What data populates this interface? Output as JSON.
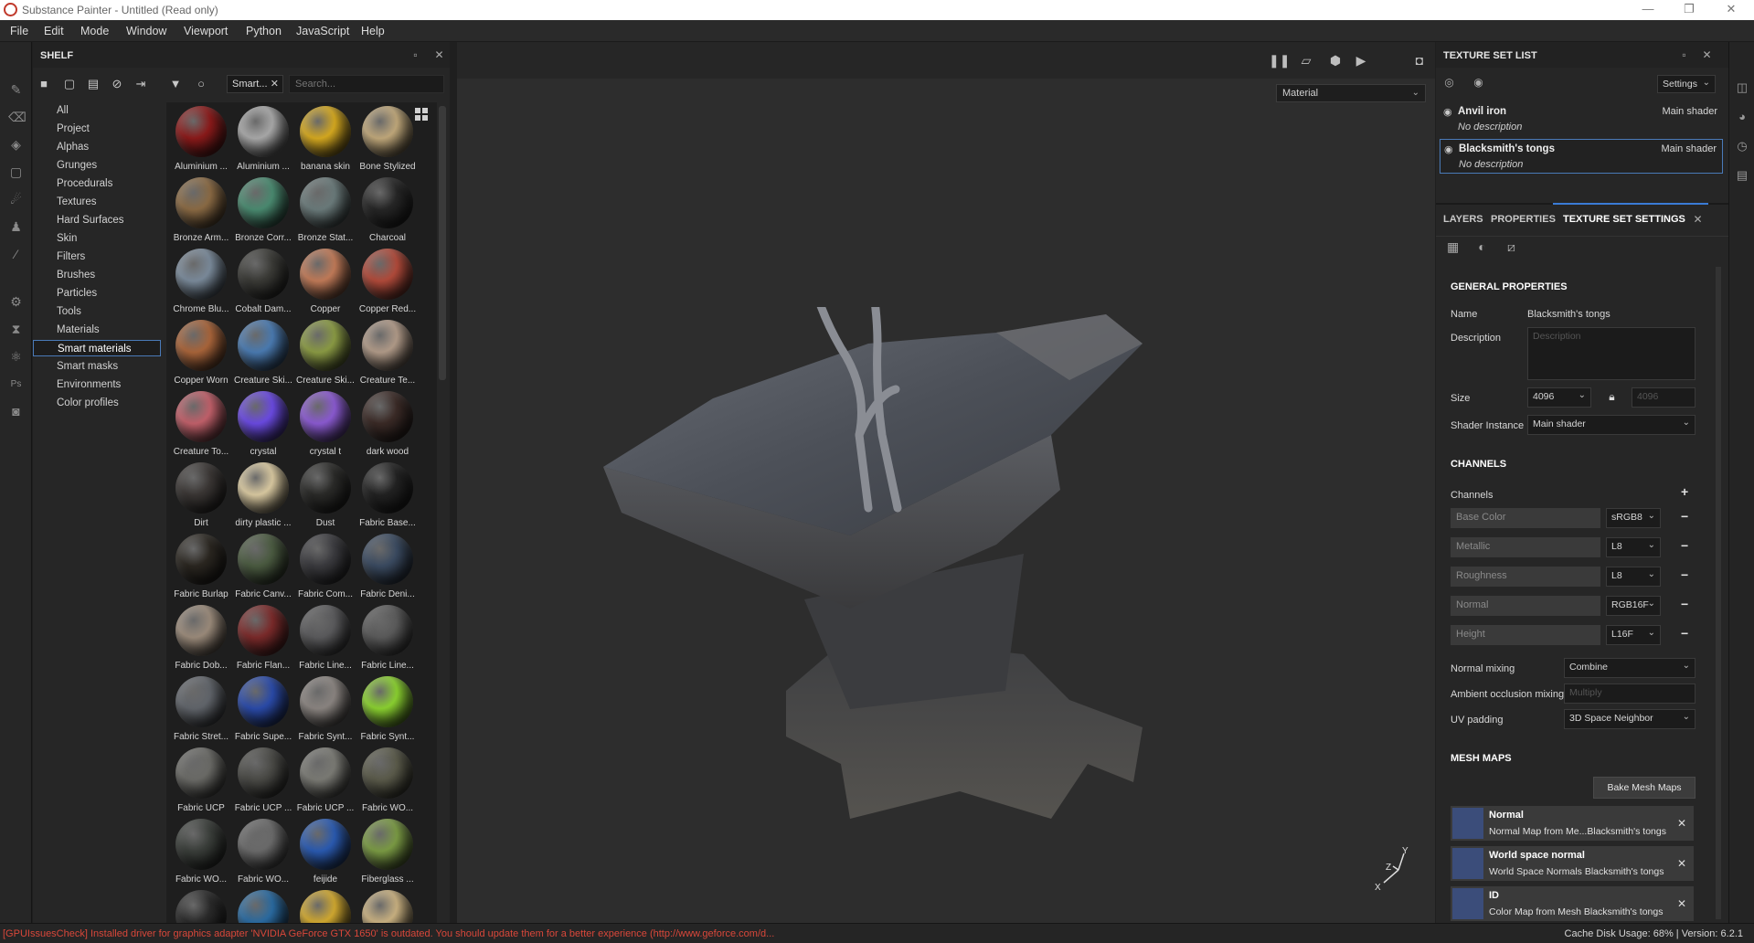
{
  "window": {
    "title": "Substance Painter - Untitled (Read only)",
    "controls": [
      "—",
      "❐",
      "✕"
    ]
  },
  "menu": [
    "File",
    "Edit",
    "Mode",
    "Window",
    "Viewport",
    "Python",
    "JavaScript",
    "Help"
  ],
  "shelf": {
    "title": "SHELF",
    "filter_tag": "Smart...",
    "search_placeholder": "Search...",
    "categories": [
      "All",
      "Project",
      "Alphas",
      "Grunges",
      "Procedurals",
      "Textures",
      "Hard Surfaces",
      "Skin",
      "Filters",
      "Brushes",
      "Particles",
      "Tools",
      "Materials",
      "Smart materials",
      "Smart masks",
      "Environments",
      "Color profiles"
    ],
    "selected_category": "Smart materials",
    "materials": [
      {
        "label": "Aluminium ...",
        "color": "#8a1a1a"
      },
      {
        "label": "Aluminium ...",
        "color": "#a8a8a8"
      },
      {
        "label": "banana skin",
        "color": "#d4a820"
      },
      {
        "label": "Bone Stylized",
        "color": "#bfa77a"
      },
      {
        "label": "Bronze Arm...",
        "color": "#8a6a44"
      },
      {
        "label": "Bronze Corr...",
        "color": "#4a8a70"
      },
      {
        "label": "Bronze Stat...",
        "color": "#6a7a7a"
      },
      {
        "label": "Charcoal",
        "color": "#262626"
      },
      {
        "label": "Chrome Blu...",
        "color": "#7a8a9a"
      },
      {
        "label": "Cobalt Dam...",
        "color": "#3a3a36"
      },
      {
        "label": "Copper",
        "color": "#c07a58"
      },
      {
        "label": "Copper Red...",
        "color": "#b04a3a"
      },
      {
        "label": "Copper Worn",
        "color": "#a8643a"
      },
      {
        "label": "Creature Ski...",
        "color": "#4a7ab0"
      },
      {
        "label": "Creature Ski...",
        "color": "#8a9a44"
      },
      {
        "label": "Creature Te...",
        "color": "#b09a88"
      },
      {
        "label": "Creature To...",
        "color": "#c0606a"
      },
      {
        "label": "crystal",
        "color": "#6a4ae0"
      },
      {
        "label": "crystal t",
        "color": "#8a5ad0"
      },
      {
        "label": "dark wood",
        "color": "#3a2a26"
      },
      {
        "label": "Dirt",
        "color": "#3a3634"
      },
      {
        "label": "dirty plastic ...",
        "color": "#d8c8a0"
      },
      {
        "label": "Dust",
        "color": "#2a2a28"
      },
      {
        "label": "Fabric Base...",
        "color": "#222222"
      },
      {
        "label": "Fabric Burlap",
        "color": "#2a2620"
      },
      {
        "label": "Fabric Canv...",
        "color": "#4a5a40"
      },
      {
        "label": "Fabric Com...",
        "color": "#3a3a3e"
      },
      {
        "label": "Fabric Deni...",
        "color": "#3a4a60"
      },
      {
        "label": "Fabric Dob...",
        "color": "#9a8a7a"
      },
      {
        "label": "Fabric Flan...",
        "color": "#7a2a2a"
      },
      {
        "label": "Fabric Line...",
        "color": "#5a5a5c"
      },
      {
        "label": "Fabric Line...",
        "color": "#5a5a5a"
      },
      {
        "label": "Fabric Stret...",
        "color": "#60646a"
      },
      {
        "label": "Fabric Supe...",
        "color": "#2a4aa8"
      },
      {
        "label": "Fabric Synt...",
        "color": "#8a8480"
      },
      {
        "label": "Fabric Synt...",
        "color": "#8ad030"
      },
      {
        "label": "Fabric UCP",
        "color": "#6a6a66"
      },
      {
        "label": "Fabric UCP ...",
        "color": "#4a4a46"
      },
      {
        "label": "Fabric UCP ...",
        "color": "#7a7a74"
      },
      {
        "label": "Fabric WO...",
        "color": "#5a5a4a"
      },
      {
        "label": "Fabric WO...",
        "color": "#3a3e3a"
      },
      {
        "label": "Fabric WO...",
        "color": "#6a6a6a"
      },
      {
        "label": "feijide",
        "color": "#2a5ab0"
      },
      {
        "label": "Fiberglass ...",
        "color": "#7a9a44"
      },
      {
        "label": "",
        "color": "#2a2a2a"
      },
      {
        "label": "",
        "color": "#2a6aa0"
      },
      {
        "label": "",
        "color": "#d0a830"
      },
      {
        "label": "",
        "color": "#c8b080"
      }
    ]
  },
  "viewport": {
    "render_mode": "Material",
    "axis": {
      "x": "X",
      "y": "Y",
      "z": "Z"
    }
  },
  "texture_set_list": {
    "title": "TEXTURE SET LIST",
    "settings_label": "Settings",
    "items": [
      {
        "name": "Anvil iron",
        "description": "No description",
        "shader": "Main shader"
      },
      {
        "name": "Blacksmith's tongs",
        "description": "No description",
        "shader": "Main shader"
      }
    ]
  },
  "tabs": [
    "LAYERS",
    "PROPERTIES",
    "TEXTURE SET SETTINGS"
  ],
  "settings": {
    "general_title": "GENERAL PROPERTIES",
    "name_label": "Name",
    "name_value": "Blacksmith's tongs",
    "description_label": "Description",
    "description_placeholder": "Description",
    "size_label": "Size",
    "size_value": "4096",
    "size_value_locked": "4096",
    "shader_label": "Shader Instance",
    "shader_value": "Main shader",
    "channels_title": "CHANNELS",
    "channels_label": "Channels",
    "channels": [
      {
        "name": "Base Color",
        "format": "sRGB8"
      },
      {
        "name": "Metallic",
        "format": "L8"
      },
      {
        "name": "Roughness",
        "format": "L8"
      },
      {
        "name": "Normal",
        "format": "RGB16F"
      },
      {
        "name": "Height",
        "format": "L16F"
      }
    ],
    "normal_mixing_label": "Normal mixing",
    "normal_mixing_value": "Combine",
    "ao_mixing_label": "Ambient occlusion mixing",
    "ao_mixing_value": "Multiply",
    "uv_padding_label": "UV padding",
    "uv_padding_value": "3D Space Neighbor",
    "mesh_maps_title": "MESH MAPS",
    "bake_button": "Bake Mesh Maps",
    "mesh_maps": [
      {
        "name": "Normal",
        "description": "Normal Map from Me...Blacksmith's tongs"
      },
      {
        "name": "World space normal",
        "description": "World Space Normals Blacksmith's tongs"
      },
      {
        "name": "ID",
        "description": "Color Map from Mesh Blacksmith's tongs"
      }
    ]
  },
  "status": {
    "message": "[GPUIssuesCheck] Installed driver for graphics adapter 'NVIDIA GeForce GTX 1650' is outdated. You should update them for a better experience (http://www.geforce.com/d...",
    "right": "Cache Disk Usage:   68% | Version: 6.2.1"
  }
}
